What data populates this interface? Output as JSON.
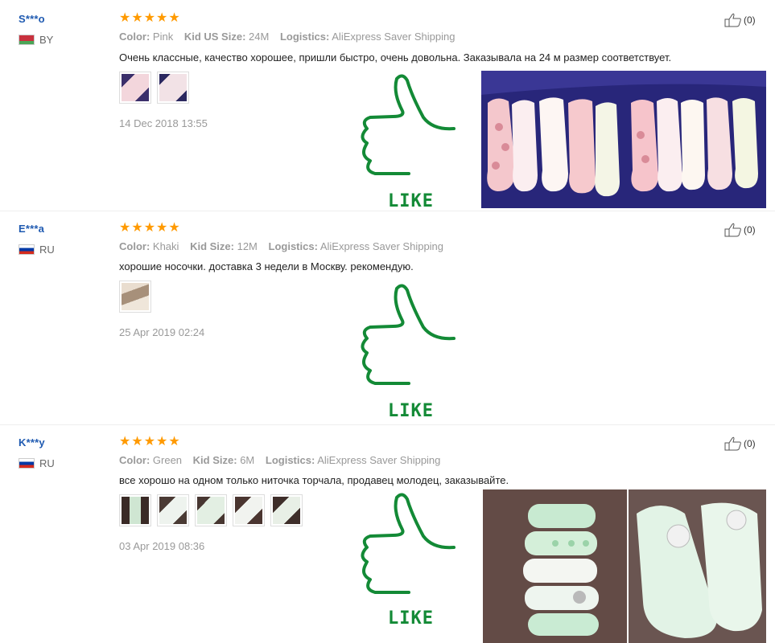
{
  "reviews": [
    {
      "user": "S***o",
      "country": "BY",
      "rating": 5,
      "properties": [
        {
          "key": "Color:",
          "value": "Pink"
        },
        {
          "key": "Kid US Size:",
          "value": "24M"
        },
        {
          "key": "Logistics:",
          "value": "AliExpress Saver Shipping"
        }
      ],
      "feedback": "Очень классные, качество хорошее, пришли быстро, очень довольна. Заказывала на 24 м размер соответствует.",
      "thumbnail_count": 2,
      "date": "14 Dec 2018 13:55",
      "useful": "(0)"
    },
    {
      "user": "E***a",
      "country": "RU",
      "rating": 5,
      "properties": [
        {
          "key": "Color:",
          "value": "Khaki"
        },
        {
          "key": "Kid Size:",
          "value": "12M"
        },
        {
          "key": "Logistics:",
          "value": "AliExpress Saver Shipping"
        }
      ],
      "feedback": "хорошие носочки. доставка 3 недели в Москву. рекомендую.",
      "thumbnail_count": 1,
      "date": "25 Apr 2019 02:24",
      "useful": "(0)"
    },
    {
      "user": "K***y",
      "country": "RU",
      "rating": 5,
      "properties": [
        {
          "key": "Color:",
          "value": "Green"
        },
        {
          "key": "Kid Size:",
          "value": "6M"
        },
        {
          "key": "Logistics:",
          "value": "AliExpress Saver Shipping"
        }
      ],
      "feedback": "все хорошо на одном только ниточка торчала, продавец молодец, заказывайте.",
      "thumbnail_count": 5,
      "date": "03 Apr 2019 08:36",
      "useful": "(0)"
    }
  ],
  "like_label": "LIKE",
  "icons": {
    "star": "star-icon",
    "thumb_up": "thumb-up-icon",
    "like_hand": "like-hand-icon"
  },
  "colors": {
    "star": "#ff9a00",
    "username": "#1f5ab1",
    "like_green": "#138a36",
    "muted": "#999999"
  }
}
